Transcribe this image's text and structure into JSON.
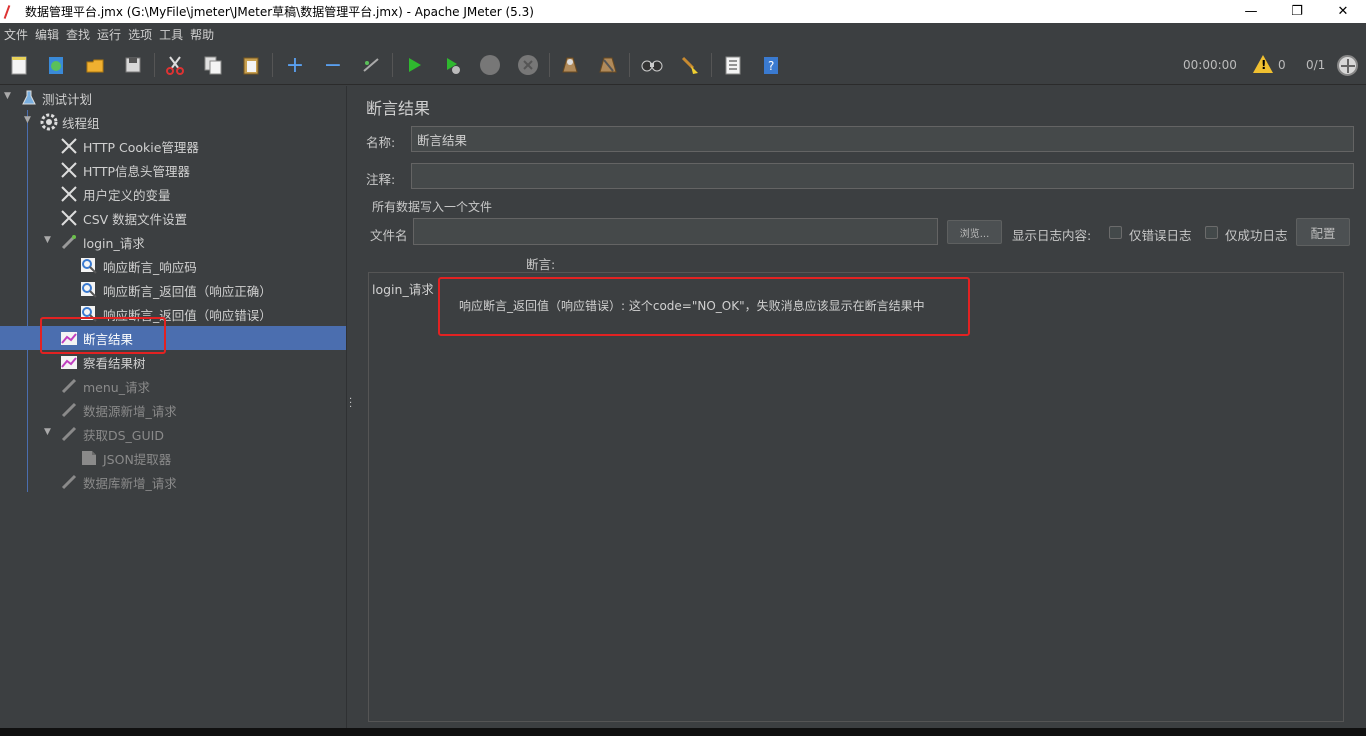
{
  "window": {
    "title": "数据管理平台.jmx (G:\\MyFile\\jmeter\\JMeter草稿\\数据管理平台.jmx) - Apache JMeter (5.3)",
    "minimize": "—",
    "maximize": "❐",
    "close": "✕"
  },
  "menu": [
    "文件",
    "编辑",
    "查找",
    "运行",
    "选项",
    "工具",
    "帮助"
  ],
  "toolbar": {
    "elapsed_time": "00:00:00",
    "warnings": "0",
    "threads": "0/1"
  },
  "tree": [
    {
      "label": "测试计划",
      "icon": "flask-icon"
    },
    {
      "label": "线程组",
      "icon": "gear-icon"
    },
    {
      "label": "HTTP Cookie管理器",
      "icon": "wrench-icon"
    },
    {
      "label": "HTTP信息头管理器",
      "icon": "wrench-icon"
    },
    {
      "label": "用户定义的变量",
      "icon": "wrench-icon"
    },
    {
      "label": "CSV 数据文件设置",
      "icon": "wrench-icon"
    },
    {
      "label": "login_请求",
      "icon": "pipette-icon"
    },
    {
      "label": "响应断言_响应码",
      "icon": "magnifier-icon"
    },
    {
      "label": "响应断言_返回值（响应正确）",
      "icon": "magnifier-icon"
    },
    {
      "label": "响应断言_返回值（响应错误）",
      "icon": "magnifier-icon"
    },
    {
      "label": "断言结果",
      "icon": "chart-icon"
    },
    {
      "label": "察看结果树",
      "icon": "chart-icon"
    },
    {
      "label": "menu_请求",
      "icon": "pipette-icon"
    },
    {
      "label": "数据源新增_请求",
      "icon": "pipette-icon"
    },
    {
      "label": "获取DS_GUID",
      "icon": "pipette-icon"
    },
    {
      "label": "JSON提取器",
      "icon": "extractor-icon"
    },
    {
      "label": "数据库新增_请求",
      "icon": "pipette-icon"
    }
  ],
  "panel": {
    "title": "断言结果",
    "name_label": "名称:",
    "name_value": "断言结果",
    "comment_label": "注释:",
    "comment_value": "",
    "group_title": "所有数据写入一个文件",
    "filename_label": "文件名",
    "filename_value": "",
    "browse_label": "浏览...",
    "log_content_label": "显示日志内容:",
    "errors_only_label": "仅错误日志",
    "success_only_label": "仅成功日志",
    "configure_label": "配置",
    "assertion_header": "断言:",
    "result_sampler": "login_请求",
    "result_message": "响应断言_返回值（响应错误）: 这个code=\"NO_OK\"，失败消息应该显示在断言结果中"
  }
}
